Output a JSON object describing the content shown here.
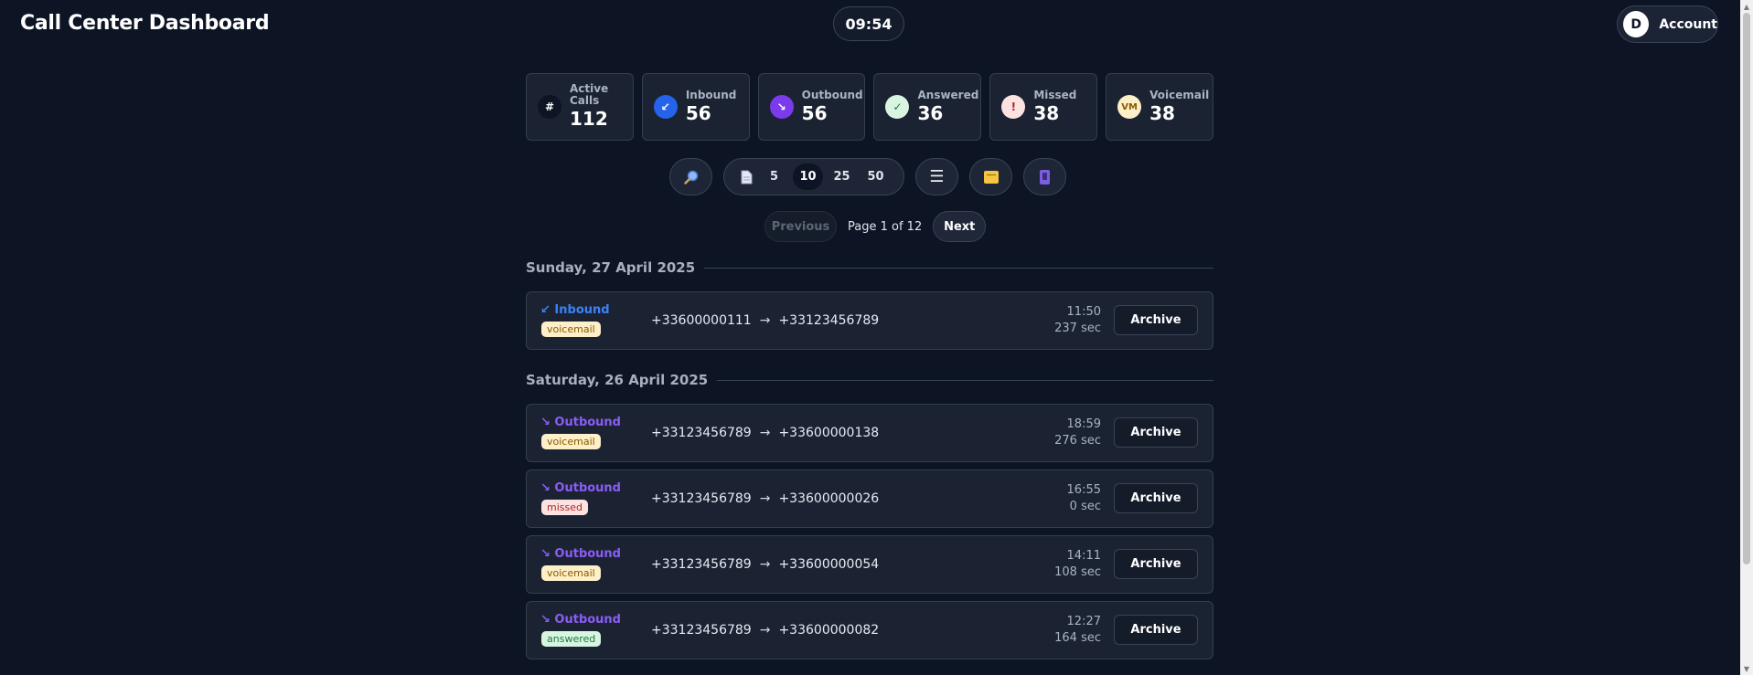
{
  "header": {
    "title": "Call Center Dashboard",
    "clock": "09:54",
    "account_initial": "D",
    "account_label": "Account"
  },
  "stats": [
    {
      "label": "Active Calls",
      "value": "112",
      "icon": "hash-icon",
      "glyph": "#",
      "icon_bg": "#0d1424",
      "icon_fg": "#ffffff"
    },
    {
      "label": "Inbound",
      "value": "56",
      "icon": "inbound-arrow-icon",
      "glyph": "↙",
      "icon_bg": "#2563eb",
      "icon_fg": "#ffffff"
    },
    {
      "label": "Outbound",
      "value": "56",
      "icon": "outbound-arrow-icon",
      "glyph": "↘",
      "icon_bg": "#7c3aed",
      "icon_fg": "#ffffff"
    },
    {
      "label": "Answered",
      "value": "36",
      "icon": "check-icon",
      "glyph": "✓",
      "icon_bg": "#d8f5e1",
      "icon_fg": "#1b7a3d"
    },
    {
      "label": "Missed",
      "value": "38",
      "icon": "exclamation-icon",
      "glyph": "!",
      "icon_bg": "#fde2e2",
      "icon_fg": "#b3261e"
    },
    {
      "label": "Voicemail",
      "value": "38",
      "icon": "voicemail-icon",
      "glyph": "VM",
      "icon_bg": "#fdefc8",
      "icon_fg": "#8a5a00"
    }
  ],
  "toolbar": {
    "search_icon": "magnifier-icon",
    "page_sizes": [
      "5",
      "10",
      "25",
      "50"
    ],
    "selected_page_size": "10"
  },
  "pagination": {
    "prev_label": "Previous",
    "info": "Page 1 of 12",
    "next_label": "Next"
  },
  "groups": [
    {
      "date": "Sunday, 27 April 2025",
      "calls": [
        {
          "direction": "inbound",
          "direction_label": "↙ Inbound",
          "status": "voicemail",
          "from": "+33600000111",
          "to": "+33123456789",
          "time": "11:50",
          "duration": "237 sec"
        }
      ]
    },
    {
      "date": "Saturday, 26 April 2025",
      "calls": [
        {
          "direction": "outbound",
          "direction_label": "↘ Outbound",
          "status": "voicemail",
          "from": "+33123456789",
          "to": "+33600000138",
          "time": "18:59",
          "duration": "276 sec"
        },
        {
          "direction": "outbound",
          "direction_label": "↘ Outbound",
          "status": "missed",
          "from": "+33123456789",
          "to": "+33600000026",
          "time": "16:55",
          "duration": "0 sec"
        },
        {
          "direction": "outbound",
          "direction_label": "↘ Outbound",
          "status": "voicemail",
          "from": "+33123456789",
          "to": "+33600000054",
          "time": "14:11",
          "duration": "108 sec"
        },
        {
          "direction": "outbound",
          "direction_label": "↘ Outbound",
          "status": "answered",
          "from": "+33123456789",
          "to": "+33600000082",
          "time": "12:27",
          "duration": "164 sec"
        }
      ]
    }
  ],
  "archive_label": "Archive",
  "route_arrow": "→"
}
